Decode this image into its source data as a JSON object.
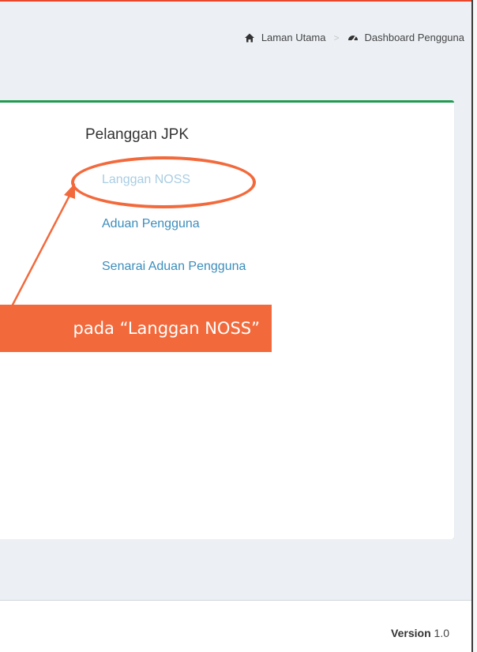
{
  "breadcrumb": {
    "home": {
      "label": "Laman Utama",
      "icon": "home-icon"
    },
    "separator": ">",
    "current": {
      "label": "Dashboard Pengguna",
      "icon": "dashboard-icon"
    }
  },
  "panel": {
    "title": "Pelanggan JPK",
    "links": [
      {
        "label": "Langgan NOSS",
        "state": "active"
      },
      {
        "label": "Aduan Pengguna"
      },
      {
        "label": "Senarai Aduan Pengguna"
      }
    ]
  },
  "footer": {
    "version_label": "Version",
    "version_value": "1.0"
  },
  "annotation": {
    "text": "pada “Langgan NOSS”",
    "color": "#f26a3c"
  },
  "colors": {
    "box_top_border": "#1e9c4b",
    "link": "#3c8dbc",
    "active_link": "#a9cde3",
    "page_bg": "#ecf0f5"
  }
}
